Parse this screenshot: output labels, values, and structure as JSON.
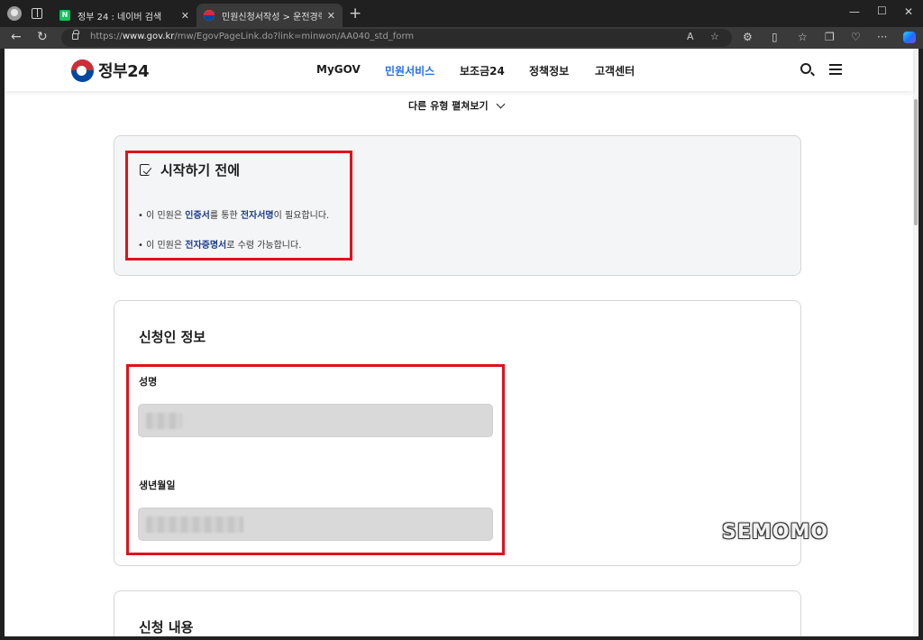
{
  "browser": {
    "tabs": [
      {
        "title": "정부 24 : 네이버 검색",
        "favicon": "naver-icon",
        "active": false
      },
      {
        "title": "민원신청서작성 > 운전경력증명",
        "favicon": "gov24-icon",
        "active": true
      }
    ],
    "url_prefix": "https://",
    "url_domain": "www.gov.kr",
    "url_path": "/mw/EgovPageLink.do?link=minwon/AA040_std_form",
    "favicon_glyph": "N"
  },
  "site": {
    "logo_text": "정부24",
    "nav": [
      "MyGOV",
      "민원서비스",
      "보조금24",
      "정책정보",
      "고객센터"
    ],
    "active_nav": "민원서비스",
    "accent_color": "#256ef4"
  },
  "expand_link": "다른 유형 펼쳐보기",
  "before": {
    "title": "시작하기 전에",
    "bullet1": {
      "pre": "이 민원은 ",
      "hl1": "인증서",
      "mid": "를 통한 ",
      "hl2": "전자서명",
      "post": "이 필요합니다."
    },
    "bullet2": {
      "pre": "이 민원은 ",
      "hl1": "전자증명서",
      "post": "로 수령 가능합니다."
    }
  },
  "applicant": {
    "title": "신청인 정보",
    "name_label": "성명",
    "birth_label": "생년월일"
  },
  "content_section": {
    "title": "신청 내용"
  },
  "highlight_color": "#e0111b",
  "watermark": "SEMOMO"
}
